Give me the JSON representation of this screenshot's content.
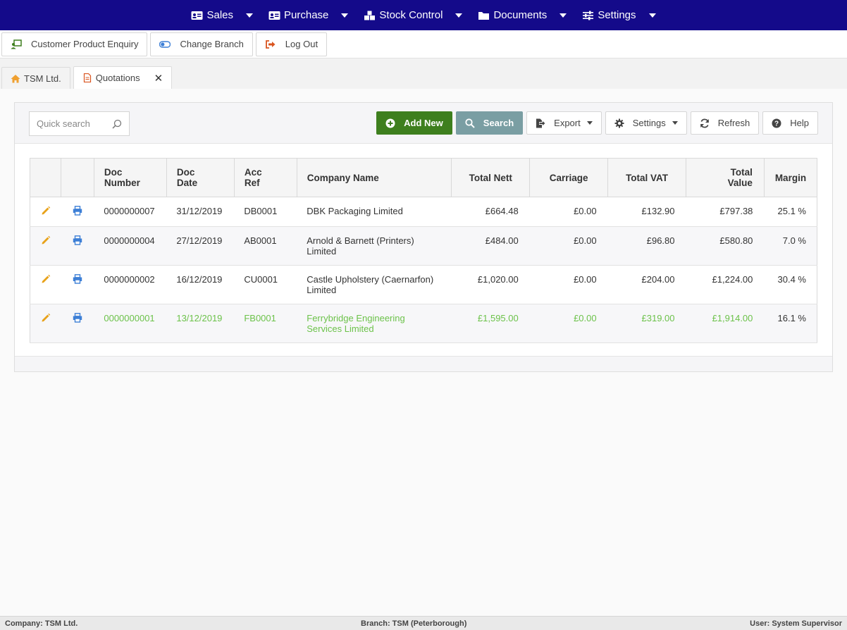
{
  "nav": {
    "items": [
      {
        "label": "Sales",
        "icon": "id-card-icon"
      },
      {
        "label": "Purchase",
        "icon": "id-card-icon"
      },
      {
        "label": "Stock Control",
        "icon": "boxes-icon"
      },
      {
        "label": "Documents",
        "icon": "folder-icon"
      },
      {
        "label": "Settings",
        "icon": "sliders-icon"
      }
    ]
  },
  "toolbar": {
    "customer_enquiry": "Customer Product Enquiry",
    "change_branch": "Change Branch",
    "log_out": "Log Out"
  },
  "tabs": {
    "home": "TSM Ltd.",
    "quotations": "Quotations",
    "close": "✕"
  },
  "search": {
    "placeholder": "Quick search"
  },
  "actions": {
    "add_new": "Add New",
    "search": "Search",
    "export": "Export",
    "settings": "Settings",
    "refresh": "Refresh",
    "help": "Help"
  },
  "colors": {
    "nav_bg": "#140a8a",
    "add_green": "#3e7f1e",
    "search_teal": "#7a9ea3",
    "highlight_green": "#6cc24a",
    "edit_orange": "#e8a21a",
    "print_blue": "#3d7fd6"
  },
  "grid": {
    "headers": {
      "doc_number_1": "Doc",
      "doc_number_2": "Number",
      "doc_date_1": "Doc",
      "doc_date_2": "Date",
      "acc_ref_1": "Acc",
      "acc_ref_2": "Ref",
      "company": "Company Name",
      "nett": "Total Nett",
      "carriage": "Carriage",
      "vat": "Total VAT",
      "value_1": "Total",
      "value_2": "Value",
      "margin": "Margin"
    },
    "rows": [
      {
        "doc": "0000000007",
        "date": "31/12/2019",
        "acc": "DB0001",
        "company_1": "DBK Packaging Limited",
        "company_2": "",
        "nett": "£664.48",
        "carriage": "£0.00",
        "vat": "£132.90",
        "value": "£797.38",
        "margin": "25.1 %"
      },
      {
        "doc": "0000000004",
        "date": "27/12/2019",
        "acc": "AB0001",
        "company_1": "Arnold & Barnett (Printers)",
        "company_2": "Limited",
        "nett": "£484.00",
        "carriage": "£0.00",
        "vat": "£96.80",
        "value": "£580.80",
        "margin": "7.0 %"
      },
      {
        "doc": "0000000002",
        "date": "16/12/2019",
        "acc": "CU0001",
        "company_1": "Castle Upholstery (Caernarfon)",
        "company_2": "Limited",
        "nett": "£1,020.00",
        "carriage": "£0.00",
        "vat": "£204.00",
        "value": "£1,224.00",
        "margin": "30.4 %"
      },
      {
        "doc": "0000000001",
        "date": "13/12/2019",
        "acc": "FB0001",
        "company_1": "Ferrybridge Engineering",
        "company_2": "Services Limited",
        "nett": "£1,595.00",
        "carriage": "£0.00",
        "vat": "£319.00",
        "value": "£1,914.00",
        "margin": "16.1 %"
      }
    ]
  },
  "status": {
    "company": "Company: TSM Ltd.",
    "branch": "Branch: TSM (Peterborough)",
    "user": "User: System Supervisor"
  }
}
